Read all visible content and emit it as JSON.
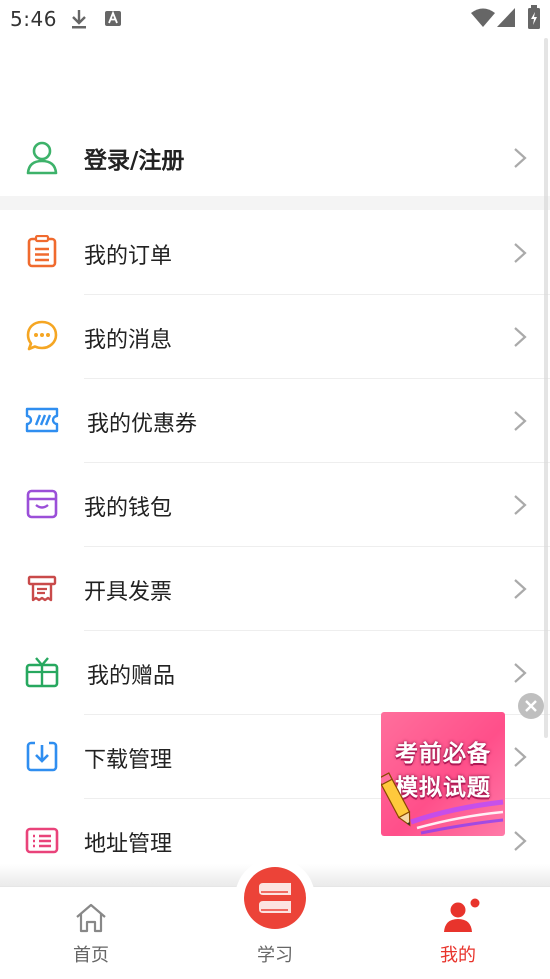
{
  "status_bar": {
    "time": "5:46",
    "icons": [
      "download-icon",
      "a-app-icon",
      "wifi-icon",
      "signal-icon",
      "battery-charging-icon"
    ]
  },
  "login": {
    "label": "登录/注册",
    "icon": "user-outline-icon",
    "color": "#3db26a"
  },
  "menu": {
    "items": [
      {
        "label": "我的订单",
        "icon": "order-list-icon",
        "color": "#f06a2e"
      },
      {
        "label": "我的消息",
        "icon": "message-bubble-icon",
        "color": "#f5a623"
      },
      {
        "label": "我的优惠券",
        "icon": "coupon-icon",
        "color": "#2f8ef0"
      },
      {
        "label": "我的钱包",
        "icon": "wallet-icon",
        "color": "#9b4fd8"
      },
      {
        "label": "开具发票",
        "icon": "invoice-icon",
        "color": "#c94a4a"
      },
      {
        "label": "我的赠品",
        "icon": "gift-tv-icon",
        "color": "#27a85f"
      },
      {
        "label": "下载管理",
        "icon": "download-box-icon",
        "color": "#2f8ef0"
      },
      {
        "label": "地址管理",
        "icon": "address-list-icon",
        "color": "#e9437a"
      }
    ]
  },
  "ad": {
    "line1": "考前必备",
    "line2": "模拟试题",
    "close_icon": "close-icon"
  },
  "bottom_nav": {
    "items": [
      {
        "label": "首页",
        "icon": "home-icon",
        "active": false
      },
      {
        "label": "学习",
        "icon": "study-book-icon",
        "active": false
      },
      {
        "label": "我的",
        "icon": "profile-icon",
        "active": true
      }
    ],
    "active_color": "#e8342c",
    "inactive_color": "#666666"
  }
}
